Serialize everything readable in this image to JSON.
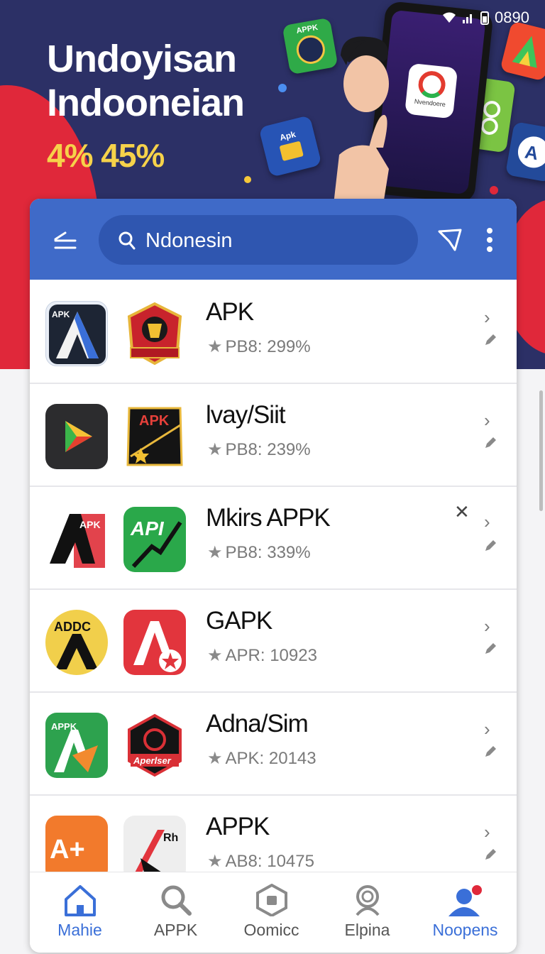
{
  "status_bar": {
    "time": "0890"
  },
  "hero": {
    "title_line1": "Undoyisan",
    "title_line2": "Indooneian",
    "subtitle": "4% 45%",
    "phone_app_label": "Nvendoere",
    "float_badge_label": "APPK",
    "apk_badge_label": "Apk"
  },
  "toolbar": {
    "search_value": "Ndonesin"
  },
  "apps": [
    {
      "title": "APK",
      "meta": "PB8: 299%",
      "icon1_text": "APK",
      "icon2_text": ""
    },
    {
      "title": "lvay/Siit",
      "meta": "PB8: 239%",
      "icon1_text": "",
      "icon2_text": "APK"
    },
    {
      "title": "Mkirs APPK",
      "meta": "PB8: 339%",
      "icon1_text": "APK",
      "icon2_text": "API"
    },
    {
      "title": "GAPK",
      "meta": "APR: 10923",
      "icon1_text": "ADDC",
      "icon2_text": ""
    },
    {
      "title": "Adna/Sim",
      "meta": "APK: 20143",
      "icon1_text": "APPK",
      "icon2_text": "Aperlser"
    },
    {
      "title": "APPK",
      "meta": "AB8: 10475",
      "icon1_text": "A+",
      "icon2_text": "Rh"
    }
  ],
  "bottom_nav": [
    {
      "label": "Mahie",
      "icon": "home-icon",
      "active": true
    },
    {
      "label": "APPK",
      "icon": "search-icon",
      "active": false
    },
    {
      "label": "Oomicc",
      "icon": "hexagon-icon",
      "active": false
    },
    {
      "label": "Elpina",
      "icon": "person-outline-icon",
      "active": false
    },
    {
      "label": "Noopens",
      "icon": "profile-icon",
      "active": true
    }
  ],
  "colors": {
    "hero_bg": "#2c3066",
    "accent_red": "#e0283a",
    "toolbar_blue": "#3f6ac8",
    "search_blue": "#2f56b0",
    "active_nav": "#3a6fd8",
    "subtitle_yellow": "#f6d24a"
  }
}
